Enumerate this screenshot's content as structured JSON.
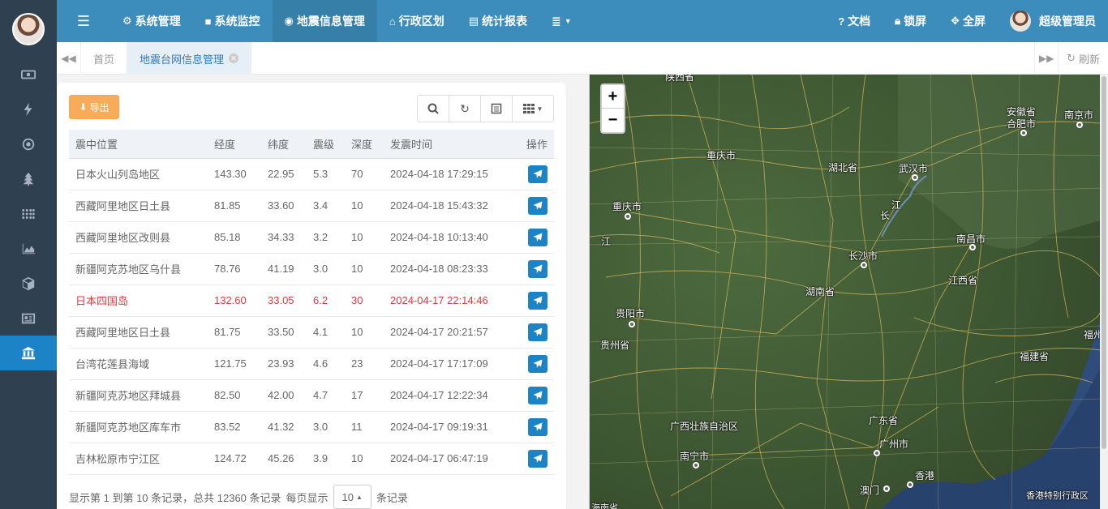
{
  "topnav": {
    "items": [
      {
        "icon": "gear-icon",
        "label": "系统管理"
      },
      {
        "icon": "video-icon",
        "label": "系统监控"
      },
      {
        "icon": "map-pin-icon",
        "label": "地震信息管理"
      },
      {
        "icon": "bank-icon",
        "label": "行政区划"
      },
      {
        "icon": "chart-icon",
        "label": "统计报表"
      }
    ],
    "docs": "文档",
    "lock": "锁屏",
    "fullscreen": "全屏",
    "user": "超级管理员"
  },
  "tabs": {
    "home": "首页",
    "active": "地震台网信息管理",
    "refresh": "刷新"
  },
  "toolbar": {
    "export": "导出"
  },
  "table": {
    "headers": [
      "震中位置",
      "经度",
      "纬度",
      "震级",
      "深度",
      "发震时间",
      "操作"
    ],
    "rows": [
      {
        "loc": "日本火山列岛地区",
        "lng": "143.30",
        "lat": "22.95",
        "mag": "5.3",
        "dep": "70",
        "time": "2024-04-18 17:29:15",
        "alert": false
      },
      {
        "loc": "西藏阿里地区日土县",
        "lng": "81.85",
        "lat": "33.60",
        "mag": "3.4",
        "dep": "10",
        "time": "2024-04-18 15:43:32",
        "alert": false
      },
      {
        "loc": "西藏阿里地区改则县",
        "lng": "85.18",
        "lat": "34.33",
        "mag": "3.2",
        "dep": "10",
        "time": "2024-04-18 10:13:40",
        "alert": false
      },
      {
        "loc": "新疆阿克苏地区乌什县",
        "lng": "78.76",
        "lat": "41.19",
        "mag": "3.0",
        "dep": "10",
        "time": "2024-04-18 08:23:33",
        "alert": false
      },
      {
        "loc": "日本四国岛",
        "lng": "132.60",
        "lat": "33.05",
        "mag": "6.2",
        "dep": "30",
        "time": "2024-04-17 22:14:46",
        "alert": true
      },
      {
        "loc": "西藏阿里地区日土县",
        "lng": "81.75",
        "lat": "33.50",
        "mag": "4.1",
        "dep": "10",
        "time": "2024-04-17 20:21:57",
        "alert": false
      },
      {
        "loc": "台湾花莲县海域",
        "lng": "121.75",
        "lat": "23.93",
        "mag": "4.6",
        "dep": "23",
        "time": "2024-04-17 17:17:09",
        "alert": false
      },
      {
        "loc": "新疆阿克苏地区拜城县",
        "lng": "82.50",
        "lat": "42.00",
        "mag": "4.7",
        "dep": "17",
        "time": "2024-04-17 12:22:34",
        "alert": false
      },
      {
        "loc": "新疆阿克苏地区库车市",
        "lng": "83.52",
        "lat": "41.32",
        "mag": "3.0",
        "dep": "11",
        "time": "2024-04-17 09:19:31",
        "alert": false
      },
      {
        "loc": "吉林松原市宁江区",
        "lng": "124.72",
        "lat": "45.26",
        "mag": "3.9",
        "dep": "10",
        "time": "2024-04-17 06:47:19",
        "alert": false
      }
    ]
  },
  "pager": {
    "summary": "显示第 1 到第 10 条记录，总共 12360 条记录",
    "per_page_label": "每页显示",
    "page_size": "10",
    "records_label": "条记录"
  },
  "map": {
    "zoom_in": "+",
    "zoom_out": "−",
    "labels": [
      {
        "text": "陕西省",
        "name": "map-label-shaanxi"
      },
      {
        "text": "安徽省",
        "name": "map-label-anhui"
      },
      {
        "text": "合肥市",
        "name": "map-label-hefei"
      },
      {
        "text": "南京市",
        "name": "map-label-nanjing"
      },
      {
        "text": "重庆市",
        "name": "map-label-chongqing-region"
      },
      {
        "text": "湖北省",
        "name": "map-label-hubei"
      },
      {
        "text": "武汉市",
        "name": "map-label-wuhan"
      },
      {
        "text": "重庆市",
        "name": "map-label-chongqing"
      },
      {
        "text": "江",
        "name": "map-label-jiang-1"
      },
      {
        "text": "长",
        "name": "map-label-chang"
      },
      {
        "text": "江",
        "name": "map-label-jiang-2"
      },
      {
        "text": "南昌市",
        "name": "map-label-nanchang"
      },
      {
        "text": "长沙市",
        "name": "map-label-changsha"
      },
      {
        "text": "湖南省",
        "name": "map-label-hunan"
      },
      {
        "text": "江西省",
        "name": "map-label-jiangxi"
      },
      {
        "text": "贵阳市",
        "name": "map-label-guiyang"
      },
      {
        "text": "贵州省",
        "name": "map-label-guizhou"
      },
      {
        "text": "福州",
        "name": "map-label-fuzhou"
      },
      {
        "text": "福建省",
        "name": "map-label-fujian"
      },
      {
        "text": "广西壮族自治区",
        "name": "map-label-guangxi"
      },
      {
        "text": "广东省",
        "name": "map-label-guangdong"
      },
      {
        "text": "南宁市",
        "name": "map-label-nanning"
      },
      {
        "text": "广州市",
        "name": "map-label-guangzhou"
      },
      {
        "text": "香港",
        "name": "map-label-hongkong"
      },
      {
        "text": "澳门",
        "name": "map-label-macau"
      },
      {
        "text": "香港特别行政区",
        "name": "map-label-hksar"
      },
      {
        "text": "海南省",
        "name": "map-label-hainan"
      }
    ]
  }
}
